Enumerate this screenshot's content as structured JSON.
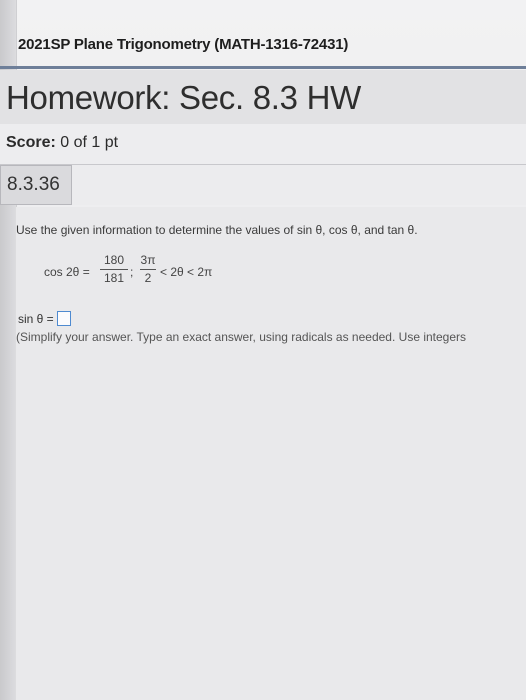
{
  "course": {
    "title": "2021SP Plane Trigonometry (MATH-1316-72431)"
  },
  "homework": {
    "title": "Homework: Sec. 8.3 HW"
  },
  "score": {
    "label": "Score:",
    "value": "0 of 1 pt"
  },
  "question": {
    "id": "8.3.36",
    "instructions": "Use the given information to determine the values of sin θ, cos θ, and tan θ.",
    "given": {
      "lhs": "cos 2θ =",
      "frac1_num": "180",
      "frac1_den": "181",
      "comma": ";",
      "frac2_num": "3π",
      "frac2_den": "2",
      "inequality": "< 2θ < 2π"
    },
    "answer_label": "sin θ =",
    "answer_value": "",
    "hint": "(Simplify your answer. Type an exact answer, using radicals as needed. Use integers"
  },
  "colors": {
    "accent_line": "#6e7f99",
    "answer_box_border": "#4e8ad0"
  }
}
